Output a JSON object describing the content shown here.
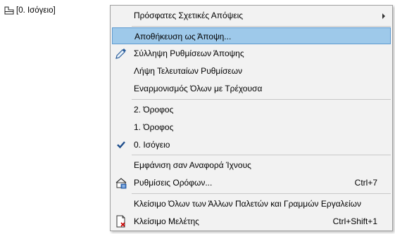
{
  "background": {
    "story_label": "[0. Ισόγειο]",
    "icon": "story-icon"
  },
  "menu": {
    "items": [
      {
        "label": "Πρόσφατες Σχετικές Απόψεις",
        "submenu": true,
        "icon": null
      },
      {
        "label": "Αποθήκευση ως Άποψη...",
        "highlighted": true,
        "icon": null
      },
      {
        "label": "Σύλληψη Ρυθμίσεων Άποψης",
        "icon": "eyedropper-icon"
      },
      {
        "label": "Λήψη Τελευταίων Ρυθμίσεων",
        "icon": null
      },
      {
        "label": "Εναρμονισμός Όλων με Τρέχουσα",
        "icon": null
      },
      {
        "label": "2. Όροφος",
        "icon": null
      },
      {
        "label": "1. Όροφος",
        "icon": null
      },
      {
        "label": "0. Ισόγειο",
        "checked": true,
        "icon": "checkmark-icon"
      },
      {
        "label": "Εμφάνιση σαν Αναφορά Ίχνους",
        "icon": null
      },
      {
        "label": "Ρυθμίσεις Ορόφων...",
        "shortcut": "Ctrl+7",
        "icon": "story-settings-icon"
      },
      {
        "label": "Κλείσιμο Όλων των Άλλων Παλετών και Γραμμών Εργαλείων",
        "icon": null
      },
      {
        "label": "Κλείσιμο Μελέτης",
        "shortcut": "Ctrl+Shift+1",
        "icon": "close-project-icon"
      }
    ]
  }
}
